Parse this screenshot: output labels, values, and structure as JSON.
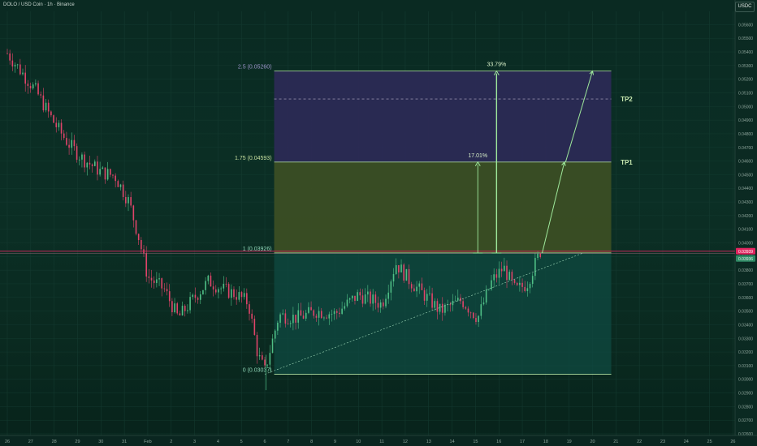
{
  "header": {
    "symbol": "DOLO / USD Coin · 1h · Binance",
    "currency": "USDC"
  },
  "colors": {
    "up": "#4fbf86",
    "down": "#e0446a",
    "tp2_zone": "#2b2a55",
    "tp1_zone": "#3b4e24",
    "base_zone": "#0f4a42",
    "level_line": "#b8e8a8",
    "arrow": "#9ee89b",
    "price_line": "#e0245e"
  },
  "chart_data": {
    "type": "candlestick",
    "title": "",
    "x_ticks": [
      "26",
      "27",
      "28",
      "29",
      "30",
      "31",
      "Feb",
      "2",
      "3",
      "4",
      "5",
      "6",
      "7",
      "8",
      "9",
      "10",
      "11",
      "12",
      "13",
      "14",
      "15",
      "16",
      "17",
      "18",
      "19",
      "20",
      "21",
      "22",
      "23",
      "24",
      "25",
      "26"
    ],
    "y_ticks": [
      "0.05600",
      "0.05500",
      "0.05400",
      "0.05300",
      "0.05200",
      "0.05100",
      "0.05000",
      "0.04900",
      "0.04800",
      "0.04700",
      "0.04600",
      "0.04500",
      "0.04400",
      "0.04300",
      "0.04200",
      "0.04100",
      "0.04000",
      "0.03900",
      "0.03800",
      "0.03700",
      "0.03600",
      "0.03500",
      "0.03400",
      "0.03300",
      "0.03200",
      "0.03100",
      "0.03000",
      "0.02900",
      "0.02800",
      "0.02700",
      "0.02600"
    ],
    "y_range": [
      0.026,
      0.0565
    ],
    "current_price": "0.03939",
    "current_price_sub": "0.03936",
    "fib_levels": [
      {
        "label": "2.5 (0.05260)",
        "ratio": 2.5,
        "price": 0.0526
      },
      {
        "label": "1.75 (0.04593)",
        "ratio": 1.75,
        "price": 0.04593
      },
      {
        "label": "1 (0.03926)",
        "ratio": 1,
        "price": 0.03926
      },
      {
        "label": "0 (0.03037)",
        "ratio": 0,
        "price": 0.03037
      }
    ],
    "targets": [
      {
        "label": "TP1",
        "price": 0.04593
      },
      {
        "label": "TP2",
        "price": 0.05055
      }
    ],
    "measures": [
      {
        "label": "17.01%",
        "from": 0.03926,
        "to": 0.04593
      },
      {
        "label": "33.79%",
        "from": 0.03926,
        "to": 0.0526
      }
    ],
    "price_path": [
      {
        "x": 0,
        "price": 0.0539
      },
      {
        "x": 1.2,
        "price": 0.0512
      },
      {
        "x": 2,
        "price": 0.0488
      },
      {
        "x": 2.6,
        "price": 0.0473
      },
      {
        "x": 3.2,
        "price": 0.0462
      },
      {
        "x": 4,
        "price": 0.0452
      },
      {
        "x": 4.6,
        "price": 0.0449
      },
      {
        "x": 5.2,
        "price": 0.043
      },
      {
        "x": 5.6,
        "price": 0.0405
      },
      {
        "x": 6,
        "price": 0.0375
      },
      {
        "x": 6.7,
        "price": 0.0366
      },
      {
        "x": 7.3,
        "price": 0.0345
      },
      {
        "x": 8,
        "price": 0.036
      },
      {
        "x": 8.6,
        "price": 0.0372
      },
      {
        "x": 9.2,
        "price": 0.0366
      },
      {
        "x": 9.8,
        "price": 0.0362
      },
      {
        "x": 10.3,
        "price": 0.0356
      },
      {
        "x": 10.7,
        "price": 0.0318
      },
      {
        "x": 11,
        "price": 0.0306
      },
      {
        "x": 11.6,
        "price": 0.0347
      },
      {
        "x": 12.4,
        "price": 0.0345
      },
      {
        "x": 13.2,
        "price": 0.035
      },
      {
        "x": 14,
        "price": 0.0348
      },
      {
        "x": 15,
        "price": 0.0362
      },
      {
        "x": 16,
        "price": 0.0355
      },
      {
        "x": 16.6,
        "price": 0.0385
      },
      {
        "x": 17.2,
        "price": 0.0372
      },
      {
        "x": 17.8,
        "price": 0.0362
      },
      {
        "x": 18.5,
        "price": 0.035
      },
      {
        "x": 19.4,
        "price": 0.0358
      },
      {
        "x": 20.1,
        "price": 0.0345
      },
      {
        "x": 20.7,
        "price": 0.0372
      },
      {
        "x": 21.2,
        "price": 0.0382
      },
      {
        "x": 21.7,
        "price": 0.0365
      },
      {
        "x": 22.2,
        "price": 0.037
      },
      {
        "x": 22.8,
        "price": 0.0395
      }
    ],
    "trendline": {
      "from": {
        "x": 11,
        "price": 0.03037
      },
      "to": {
        "x": 24.6,
        "price": 0.03926
      }
    },
    "projection": [
      {
        "x": 22.85,
        "price": 0.03926
      },
      {
        "x": 23.8,
        "price": 0.04593
      },
      {
        "x": 23.85,
        "price": 0.04593
      },
      {
        "x": 25.0,
        "price": 0.0526
      }
    ]
  }
}
